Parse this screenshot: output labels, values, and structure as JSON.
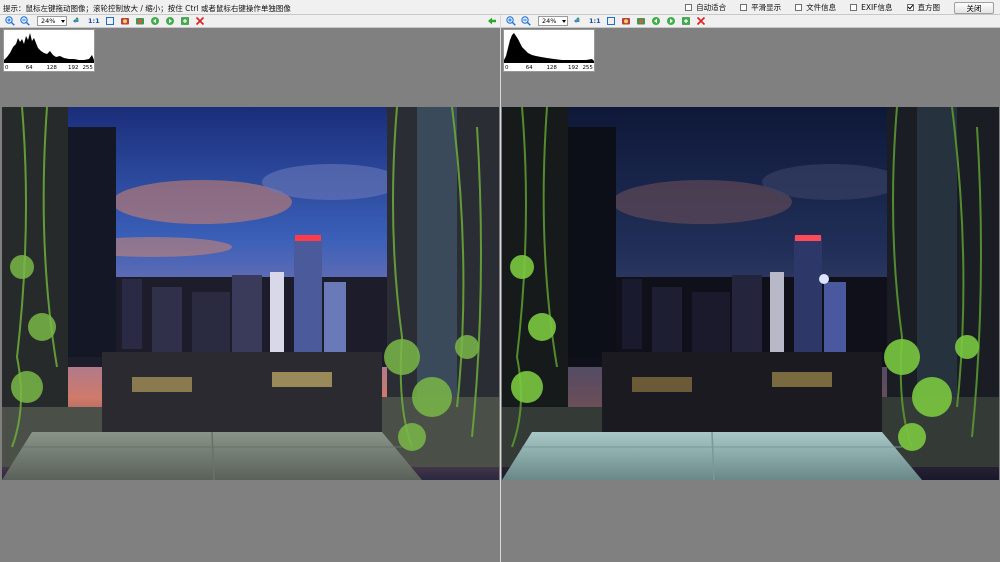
{
  "hint": {
    "text": "提示：鼠标左键拖动图像；滚轮控制放大 / 缩小；按住 Ctrl 或者鼠标右键操作单独图像"
  },
  "options": [
    {
      "label": "自动适合",
      "checked": false
    },
    {
      "label": "平滑显示",
      "checked": false
    },
    {
      "label": "文件信息",
      "checked": false
    },
    {
      "label": "EXIF信息",
      "checked": false
    },
    {
      "label": "直方图",
      "checked": true
    }
  ],
  "close_button": {
    "label": "关闭"
  },
  "left_toolbar": {
    "zoom_value": "24%",
    "one_to_one_label": "1:1",
    "icons": [
      "zoom-in-icon",
      "zoom-out-icon",
      "zoom-select-icon",
      "pan-icon",
      "fit-window-icon",
      "rotate-left-icon",
      "rotate-right-icon",
      "flip-horizontal-icon",
      "flip-vertical-icon",
      "save-icon",
      "close-image-icon"
    ]
  },
  "right_toolbar": {
    "zoom_value": "24%",
    "one_to_one_label": "1:1",
    "icons": [
      "zoom-in-icon",
      "zoom-out-icon",
      "zoom-select-icon",
      "pan-icon",
      "fit-window-icon",
      "rotate-left-icon",
      "rotate-right-icon",
      "flip-horizontal-icon",
      "flip-vertical-icon",
      "save-icon",
      "close-image-icon"
    ]
  },
  "histogram": {
    "ticks": [
      "0",
      "64",
      "128",
      "192",
      "255"
    ]
  },
  "colors": {
    "toolbar_bg": "#f0f0f0",
    "workspace_bg": "#808080",
    "zoom_icon": "#1f6fd1",
    "close_x": "#e02020",
    "back_arrow": "#2aa82a"
  }
}
